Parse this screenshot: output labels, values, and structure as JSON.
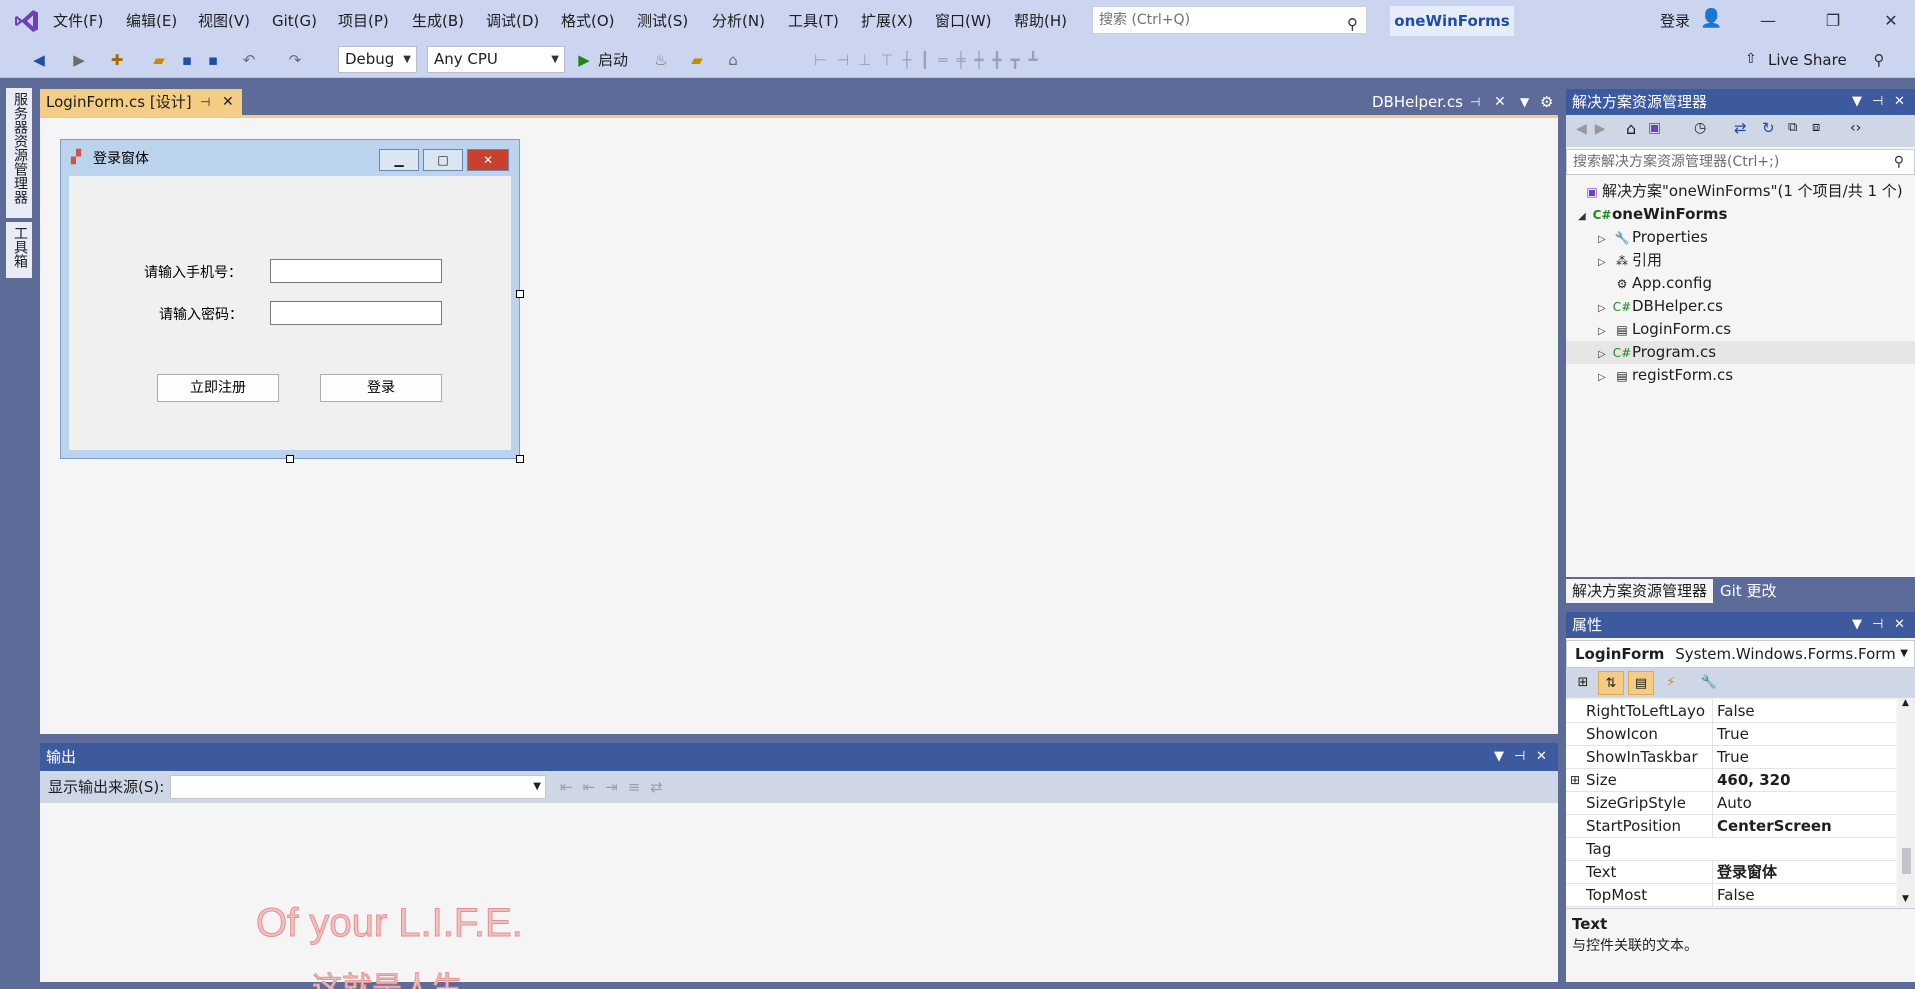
{
  "menu": [
    "文件(F)",
    "编辑(E)",
    "视图(V)",
    "Git(G)",
    "项目(P)",
    "生成(B)",
    "调试(D)",
    "格式(O)",
    "测试(S)",
    "分析(N)",
    "工具(T)",
    "扩展(X)",
    "窗口(W)",
    "帮助(H)"
  ],
  "search_placeholder": "搜索 (Ctrl+Q)",
  "solution_name": "oneWinForms",
  "sign_in": "登录",
  "toolbar": {
    "config": "Debug",
    "platform": "Any CPU",
    "start": "启动",
    "live_share": "Live Share"
  },
  "left_strip": {
    "server_explorer": "服务器资源管理器",
    "toolbox": "工具箱"
  },
  "doc_tabs": {
    "active": "LoginForm.cs [设计]",
    "other": "DBHelper.cs"
  },
  "designer": {
    "form_title": "登录窗体",
    "phone_label": "请输入手机号：",
    "password_label": "请输入密码：",
    "register_button": "立即注册",
    "login_button": "登录"
  },
  "output": {
    "title": "输出",
    "source_label": "显示输出来源(S):",
    "watermark_line1": "Of your L.I.F.E.",
    "watermark_line2": "这就是人生"
  },
  "solution_explorer": {
    "title": "解决方案资源管理器",
    "search_placeholder": "搜索解决方案资源管理器(Ctrl+;)",
    "solution_line": "解决方案\"oneWinForms\"(1 个项目/共 1 个)",
    "project": "oneWinForms",
    "items": [
      "Properties",
      "引用",
      "App.config",
      "DBHelper.cs",
      "LoginForm.cs",
      "Program.cs",
      "registForm.cs"
    ],
    "tab_se": "解决方案资源管理器",
    "tab_git": "Git 更改"
  },
  "properties": {
    "title": "属性",
    "object_name": "LoginForm",
    "object_type": "System.Windows.Forms.Form",
    "rows": [
      {
        "name": "RightToLeftLayo",
        "value": "False"
      },
      {
        "name": "ShowIcon",
        "value": "True"
      },
      {
        "name": "ShowInTaskbar",
        "value": "True"
      },
      {
        "name": "Size",
        "value": "460, 320"
      },
      {
        "name": "SizeGripStyle",
        "value": "Auto"
      },
      {
        "name": "StartPosition",
        "value": "CenterScreen"
      },
      {
        "name": "Tag",
        "value": ""
      },
      {
        "name": "Text",
        "value": "登录窗体"
      },
      {
        "name": "TopMost",
        "value": "False"
      }
    ],
    "desc_title": "Text",
    "desc_body": "与控件关联的文本。"
  },
  "colors": {
    "accent": "#3e5a9e",
    "tab_active": "#f5cc84",
    "chrome": "#ccd5f0",
    "frame": "#5d6b99"
  }
}
